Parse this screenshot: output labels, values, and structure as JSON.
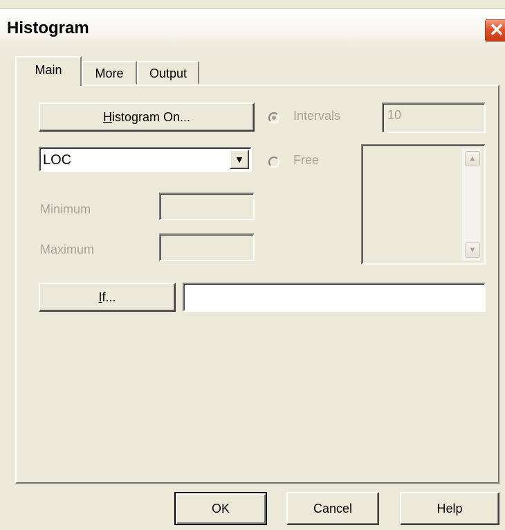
{
  "window": {
    "title": "Histogram",
    "close_glyph": "✕"
  },
  "tabs": [
    {
      "label": "Main"
    },
    {
      "label": "More"
    },
    {
      "label": "Output"
    }
  ],
  "main": {
    "histogram_on_button": {
      "underlined": "H",
      "rest": "istogram On..."
    },
    "variable_select": {
      "value": "LOC"
    },
    "minimum": {
      "label": "Minimum",
      "value": ""
    },
    "maximum": {
      "label": "Maximum",
      "value": ""
    },
    "intervals": {
      "label": "Intervals",
      "value": "10",
      "selected": true
    },
    "free": {
      "label": "Free",
      "selected": false
    },
    "if_button": {
      "underlined": "I",
      "rest": "f..."
    },
    "if_expression": {
      "value": ""
    }
  },
  "footer": {
    "ok_label": "OK",
    "cancel_label": "Cancel",
    "help_label": "Help"
  },
  "icons": {
    "dropdown": "chevron-down-icon",
    "close": "close-icon",
    "scroll_up": "scroll-up-icon",
    "scroll_down": "scroll-down-icon"
  },
  "colors": {
    "dialog_bg": "#ece9d8",
    "close_button": "#e0542c",
    "disabled_text": "#a6a497"
  }
}
